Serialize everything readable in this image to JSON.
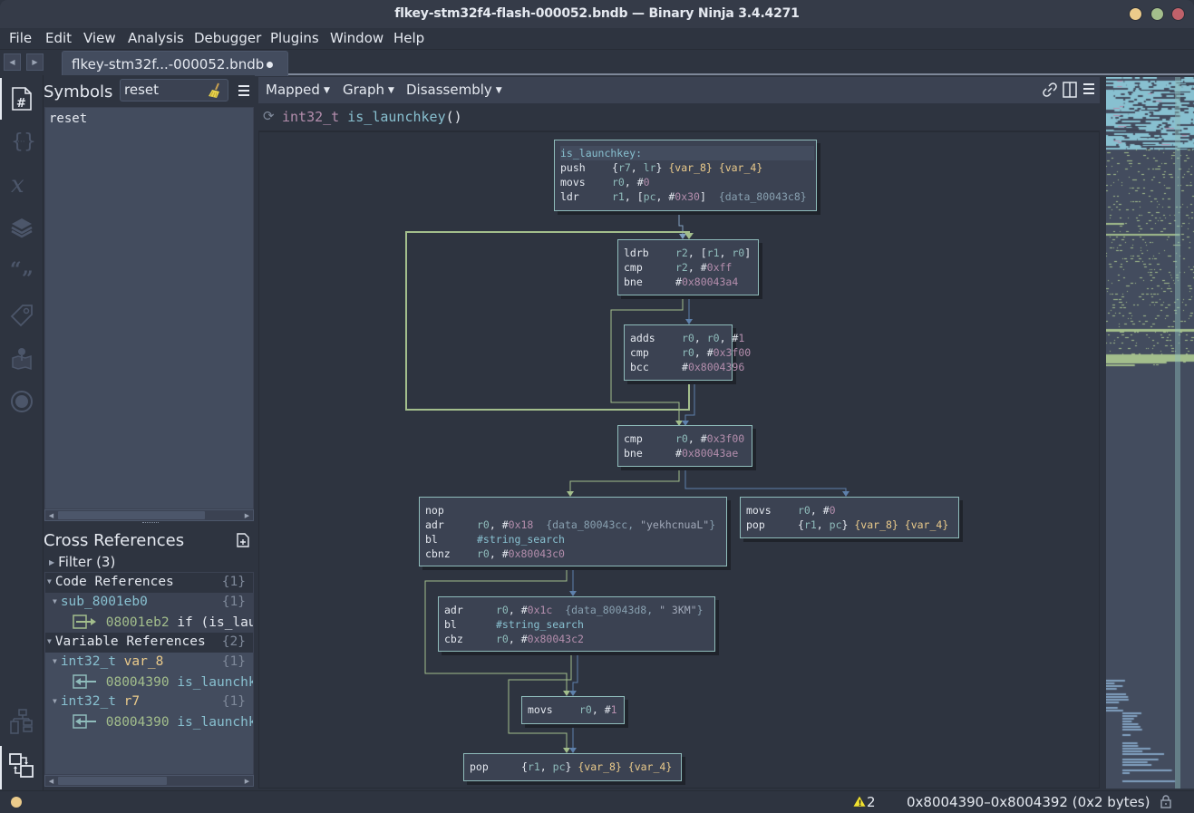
{
  "window": {
    "title": "flkey-stm32f4-flash-000052.bndb — Binary Ninja 3.4.4271",
    "controls": [
      {
        "name": "minimize",
        "color": "#ebcb8b"
      },
      {
        "name": "maximize",
        "color": "#a3be8c"
      },
      {
        "name": "close",
        "color": "#bf616a"
      }
    ]
  },
  "menu": [
    "File",
    "Edit",
    "View",
    "Analysis",
    "Debugger",
    "Plugins",
    "Window",
    "Help"
  ],
  "tabs": [
    {
      "label": "flkey-stm32f...-000052.bndb",
      "modified": true,
      "active": true
    }
  ],
  "rail": {
    "top_icons": [
      "symbols-icon",
      "types-icon",
      "variables-icon",
      "stack-layers-icon",
      "strings-icon",
      "tags-icon",
      "memory-map-icon",
      "debugger-icon"
    ],
    "bottom_icons": [
      "call-graph-icon",
      "cross-references-icon"
    ],
    "active_top": "symbols-icon",
    "active_bottom": "cross-references-icon"
  },
  "symbols": {
    "title": "Symbols",
    "search_value": "reset",
    "results": [
      "reset"
    ]
  },
  "xrefs": {
    "title": "Cross References",
    "filter_label": "Filter (3)",
    "code_refs": {
      "label": "Code References",
      "count": "{1}",
      "functions": [
        {
          "name": "sub_8001eb0",
          "count": "{1}",
          "refs": [
            {
              "addr": "08001eb2",
              "text": "if (is_lau"
            }
          ]
        }
      ]
    },
    "var_refs": {
      "label": "Variable References",
      "count": "{2}",
      "vars": [
        {
          "type": "int32_t",
          "name": "var_8",
          "count": "{1}",
          "refs": [
            {
              "addr": "08004390",
              "text": "is_launchk"
            }
          ]
        },
        {
          "type": "int32_t",
          "name": "r7",
          "count": "{1}",
          "refs": [
            {
              "addr": "08004390",
              "text": "is_launchk"
            }
          ]
        }
      ]
    }
  },
  "viewbar": {
    "dropdowns": [
      "Mapped",
      "Graph",
      "Disassembly"
    ],
    "icons": [
      "link-icon",
      "split-view-icon",
      "hamburger-menu-icon"
    ]
  },
  "function_header": {
    "return_type": "int32_t",
    "name": "is_launchkey",
    "params": "()"
  },
  "graph": {
    "blocks": [
      {
        "id": "b0",
        "label": "is_launchkey:",
        "lines": [
          [
            [
              "mn",
              "push"
            ],
            [
              "pun",
              "{"
            ],
            [
              "reg",
              "r7"
            ],
            [
              "pun",
              ", "
            ],
            [
              "reg",
              "lr"
            ],
            [
              "pun",
              "} "
            ],
            [
              "var",
              "{var_8}"
            ],
            [
              "pun",
              " "
            ],
            [
              "var",
              "{var_4}"
            ]
          ],
          [
            [
              "mn",
              "movs"
            ],
            [
              "reg",
              "r0"
            ],
            [
              "pun",
              ", #"
            ],
            [
              "imm",
              "0"
            ]
          ],
          [
            [
              "mn",
              "ldr"
            ],
            [
              "reg",
              "r1"
            ],
            [
              "pun",
              ", ["
            ],
            [
              "reg",
              "pc"
            ],
            [
              "pun",
              ", #"
            ],
            [
              "imm",
              "0x30"
            ],
            [
              "pun",
              "]  "
            ],
            [
              "dat",
              "{data_80043c8}"
            ]
          ]
        ]
      },
      {
        "id": "b1",
        "lines": [
          [
            [
              "mn",
              "ldrb"
            ],
            [
              "reg",
              "r2"
            ],
            [
              "pun",
              ", ["
            ],
            [
              "reg",
              "r1"
            ],
            [
              "pun",
              ", "
            ],
            [
              "reg",
              "r0"
            ],
            [
              "pun",
              "]"
            ]
          ],
          [
            [
              "mn",
              "cmp"
            ],
            [
              "reg",
              "r2"
            ],
            [
              "pun",
              ", #"
            ],
            [
              "imm",
              "0xff"
            ]
          ],
          [
            [
              "mn",
              "bne"
            ],
            [
              "pun",
              "#"
            ],
            [
              "imm",
              "0x80043a4"
            ]
          ]
        ]
      },
      {
        "id": "b2",
        "lines": [
          [
            [
              "mn",
              "adds"
            ],
            [
              "reg",
              "r0"
            ],
            [
              "pun",
              ", "
            ],
            [
              "reg",
              "r0"
            ],
            [
              "pun",
              ", #"
            ],
            [
              "imm",
              "1"
            ]
          ],
          [
            [
              "mn",
              "cmp"
            ],
            [
              "reg",
              "r0"
            ],
            [
              "pun",
              ", #"
            ],
            [
              "imm",
              "0x3f00"
            ]
          ],
          [
            [
              "mn",
              "bcc"
            ],
            [
              "pun",
              "#"
            ],
            [
              "imm",
              "0x8004396"
            ]
          ]
        ]
      },
      {
        "id": "b3",
        "lines": [
          [
            [
              "mn",
              "cmp"
            ],
            [
              "reg",
              "r0"
            ],
            [
              "pun",
              ", #"
            ],
            [
              "imm",
              "0x3f00"
            ]
          ],
          [
            [
              "mn",
              "bne"
            ],
            [
              "pun",
              "#"
            ],
            [
              "imm",
              "0x80043ae"
            ]
          ]
        ]
      },
      {
        "id": "b4",
        "lines": [
          [
            [
              "mn",
              "nop"
            ]
          ],
          [
            [
              "mn",
              "adr"
            ],
            [
              "reg",
              "r0"
            ],
            [
              "pun",
              ", #"
            ],
            [
              "imm",
              "0x18"
            ],
            [
              "pun",
              "  "
            ],
            [
              "dat",
              "{data_80043cc, "
            ],
            [
              "str",
              "\"yekhcnuaL\""
            ],
            [
              "dat",
              "}"
            ]
          ],
          [
            [
              "mn",
              "bl"
            ],
            [
              "sym",
              "#string_search"
            ]
          ],
          [
            [
              "mn",
              "cbnz"
            ],
            [
              "reg",
              "r0"
            ],
            [
              "pun",
              ", #"
            ],
            [
              "imm",
              "0x80043c0"
            ]
          ]
        ]
      },
      {
        "id": "b5",
        "lines": [
          [
            [
              "mn",
              "movs"
            ],
            [
              "reg",
              "r0"
            ],
            [
              "pun",
              ", #"
            ],
            [
              "imm",
              "0"
            ]
          ],
          [
            [
              "mn",
              "pop"
            ],
            [
              "pun",
              "{"
            ],
            [
              "reg",
              "r1"
            ],
            [
              "pun",
              ", "
            ],
            [
              "reg",
              "pc"
            ],
            [
              "pun",
              "} "
            ],
            [
              "var",
              "{var_8}"
            ],
            [
              "pun",
              " "
            ],
            [
              "var",
              "{var_4}"
            ]
          ]
        ]
      },
      {
        "id": "b6",
        "lines": [
          [
            [
              "mn",
              "adr"
            ],
            [
              "reg",
              "r0"
            ],
            [
              "pun",
              ", #"
            ],
            [
              "imm",
              "0x1c"
            ],
            [
              "pun",
              "  "
            ],
            [
              "dat",
              "{data_80043d8, "
            ],
            [
              "str",
              "\" 3KM\""
            ],
            [
              "dat",
              "}"
            ]
          ],
          [
            [
              "mn",
              "bl"
            ],
            [
              "sym",
              "#string_search"
            ]
          ],
          [
            [
              "mn",
              "cbz"
            ],
            [
              "reg",
              "r0"
            ],
            [
              "pun",
              ", #"
            ],
            [
              "imm",
              "0x80043c2"
            ]
          ]
        ]
      },
      {
        "id": "b7",
        "lines": [
          [
            [
              "mn",
              "movs"
            ],
            [
              "reg",
              "r0"
            ],
            [
              "pun",
              ", #"
            ],
            [
              "imm",
              "1"
            ]
          ]
        ]
      },
      {
        "id": "b8",
        "lines": [
          [
            [
              "mn",
              "pop"
            ],
            [
              "pun",
              "{"
            ],
            [
              "reg",
              "r1"
            ],
            [
              "pun",
              ", "
            ],
            [
              "reg",
              "pc"
            ],
            [
              "pun",
              "} "
            ],
            [
              "var",
              "{var_8}"
            ],
            [
              "pun",
              " "
            ],
            [
              "var",
              "{var_4}"
            ]
          ]
        ]
      }
    ],
    "edges": [
      {
        "from": "b0",
        "to": "b1",
        "kind": "unconditional"
      },
      {
        "from": "b1",
        "to": "b2",
        "kind": "false"
      },
      {
        "from": "b1",
        "to": "b3",
        "kind": "true"
      },
      {
        "from": "b2",
        "to": "b1",
        "kind": "true",
        "backedge": true
      },
      {
        "from": "b2",
        "to": "b3",
        "kind": "false"
      },
      {
        "from": "b3",
        "to": "b4",
        "kind": "true"
      },
      {
        "from": "b3",
        "to": "b5",
        "kind": "false"
      },
      {
        "from": "b4",
        "to": "b7",
        "kind": "true"
      },
      {
        "from": "b4",
        "to": "b6",
        "kind": "false"
      },
      {
        "from": "b6",
        "to": "b8",
        "kind": "true"
      },
      {
        "from": "b6",
        "to": "b7",
        "kind": "false"
      },
      {
        "from": "b7",
        "to": "b8",
        "kind": "unconditional"
      }
    ],
    "edge_colors": {
      "true": "#a3be8c",
      "false": "#5e81ac",
      "unconditional": "#81a1c1"
    }
  },
  "status": {
    "warning_count": "2",
    "address_range": "0x8004390–0x8004392 (0x2 bytes)"
  }
}
